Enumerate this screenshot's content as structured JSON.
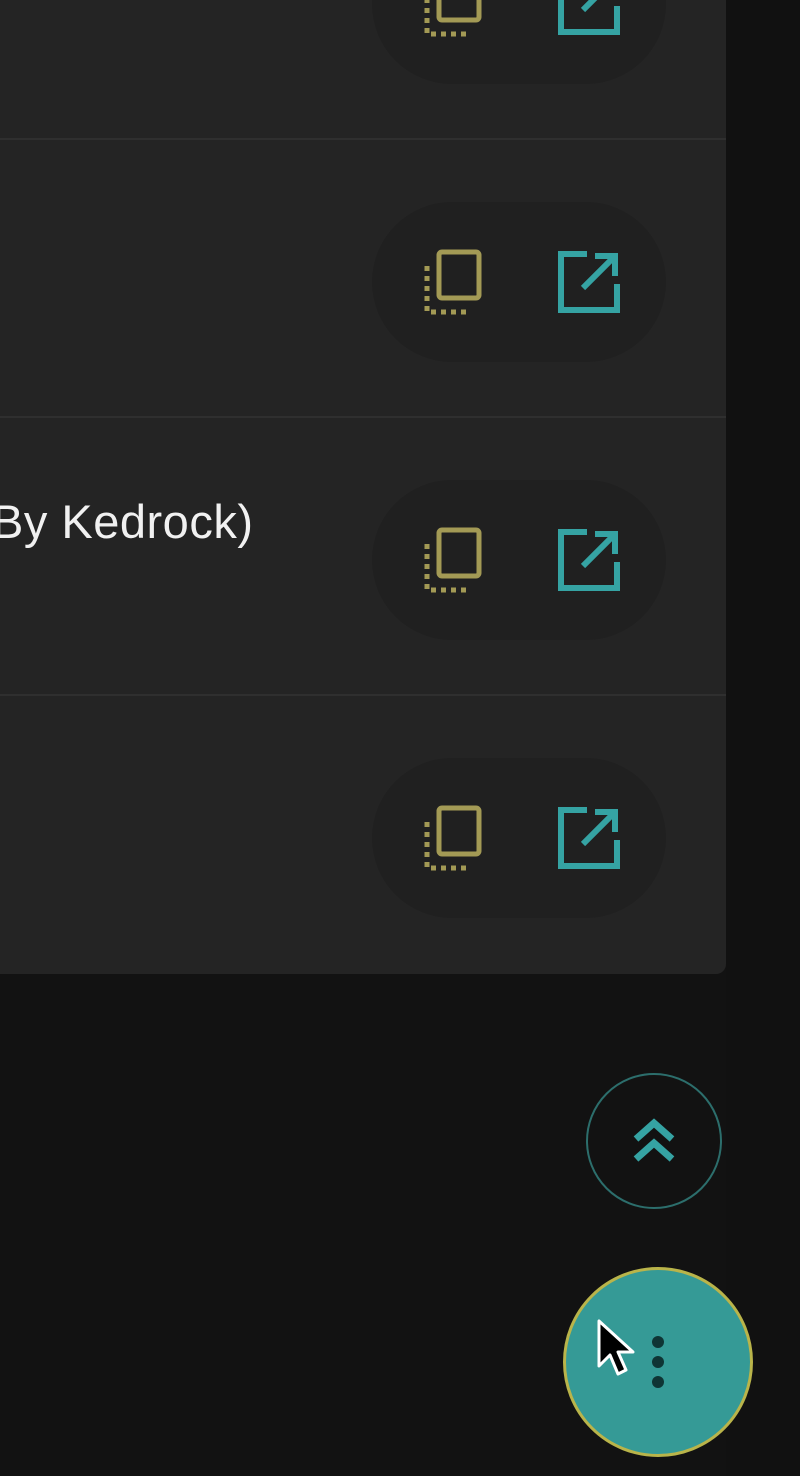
{
  "rows": [
    {
      "text": ""
    },
    {
      "text": ""
    },
    {
      "text": "By Kedrock)"
    },
    {
      "text": ""
    }
  ],
  "icons": {
    "copy": "copy-icon",
    "open": "open-external-icon",
    "scroll_top": "double-chevron-up-icon",
    "menu": "more-vertical-icon",
    "cursor": "mouse-pointer"
  },
  "colors": {
    "background": "#121212",
    "card": "#242424",
    "copy_icon": "#a39a55",
    "open_icon": "#35a3a3",
    "fab": "#359a96",
    "fab_border": "#b9b44a",
    "text": "#f1f1f1"
  }
}
